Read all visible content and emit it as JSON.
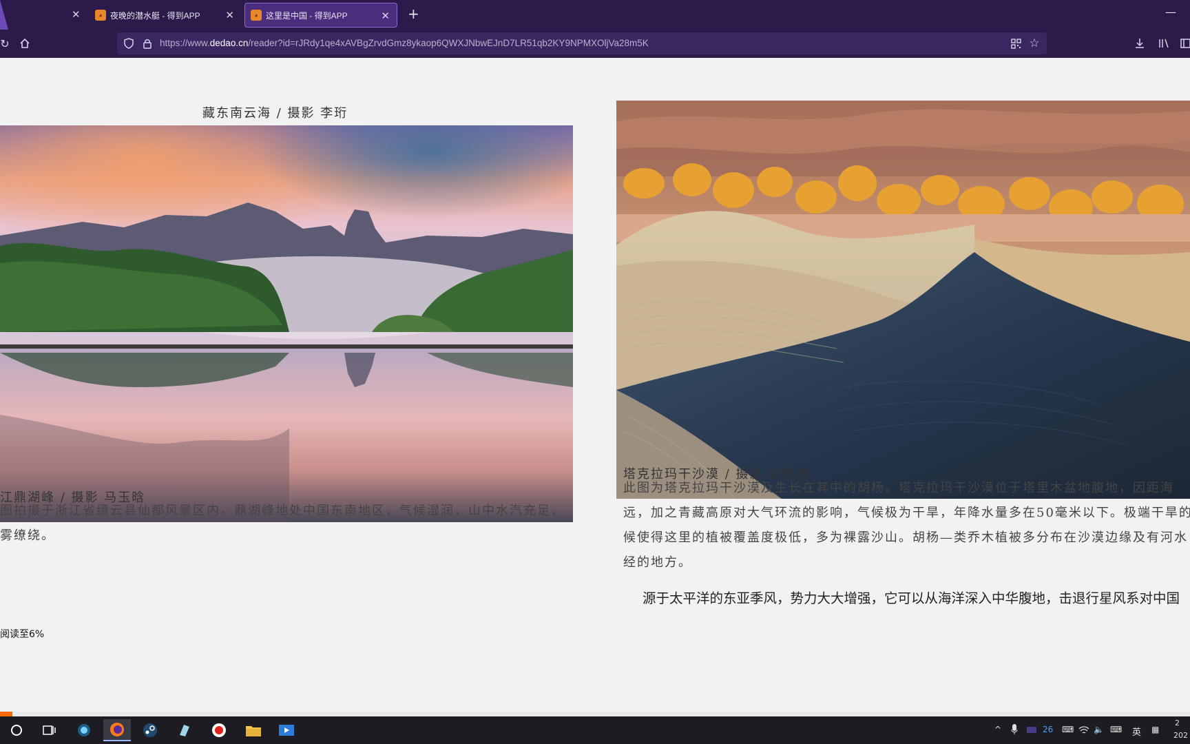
{
  "browser": {
    "tabs": [
      {
        "title": "夜晚的潜水艇 - 得到APP",
        "active": false
      },
      {
        "title": "这里是中国 - 得到APP",
        "active": true
      }
    ],
    "new_tab_label": "+",
    "url_prefix": "https://www.",
    "url_domain": "dedao.cn",
    "url_path": "/reader?id=rJRdy1qe4xAVBgZrvdGmz8ykaop6QWXJNbwEJnD7LR51qb2KY9NPMXOljVa28m5K",
    "accent_color": "#2b1a4a"
  },
  "article": {
    "left": {
      "top_caption": "藏东南云海 / 摄影 李珩",
      "photo_icon": "lake-mountain-photo",
      "caption": "江鼎湖峰 / 摄影 马玉晗",
      "desc_lines": [
        "图拍摄于浙江省缙云县仙都风景区内。鼎湖峰地处中国东南地区，气候湿润，山中水汽充足，",
        "雾缭绕。"
      ]
    },
    "right": {
      "photo_icon": "desert-dune-photo",
      "caption": "塔克拉玛干沙漠 / 摄影 赵来清",
      "desc_lines": [
        "此图为塔克拉玛干沙漠及生长在其中的胡杨。塔克拉玛干沙漠位于塔里木盆地腹地，因距海",
        "远，加之青藏高原对大气环流的影响，气候极为干旱，年降水量多在50毫米以下。极端干旱的",
        "候使得这里的植被覆盖度极低，多为裸露沙山。胡杨—类乔木植被多分布在沙漠边缘及有河水",
        "经的地方。"
      ],
      "body_text": "源于太平洋的东亚季风，势力大大增强，它可以从海洋深入中华腹地，击退行星风系对中国"
    },
    "progress_label": "阅读至6%",
    "progress_value": 0.06,
    "progress_color": "#ff6a00"
  },
  "taskbar": {
    "tray_ime": "英",
    "tray_badge": "26",
    "clock_time": "2",
    "clock_date": "202"
  }
}
